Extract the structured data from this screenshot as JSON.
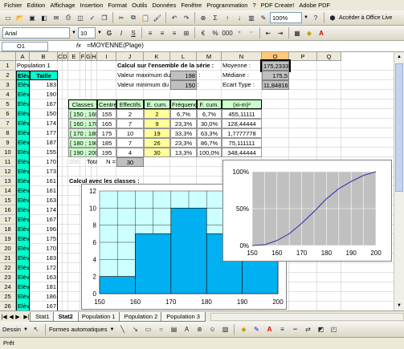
{
  "menu": [
    "Fichier",
    "Edition",
    "Affichage",
    "Insertion",
    "Format",
    "Outils",
    "Données",
    "Fenêtre",
    "Programmation",
    "?",
    "PDF Create!",
    "Adobe PDF"
  ],
  "toolbar": {
    "zoom": "100%",
    "font": "Arial",
    "font_size": "10",
    "office_live": "Accéder à Office Live"
  },
  "formula_bar": {
    "name_box": "O1",
    "fx": "fx",
    "formula": "=MOYENNE(Plage)"
  },
  "columns": [
    "A",
    "B",
    "C",
    "D",
    "E",
    "F",
    "G",
    "H",
    "I",
    "J",
    "K",
    "L",
    "M",
    "N",
    "O",
    "P",
    "Q"
  ],
  "rows": [
    "1",
    "2",
    "3",
    "4",
    "5",
    "6",
    "7",
    "8",
    "9",
    "10",
    "11",
    "12",
    "13",
    "14",
    "15",
    "16",
    "17",
    "18",
    "19",
    "20",
    "21",
    "22",
    "23",
    "24",
    "25",
    "26"
  ],
  "population": {
    "title": "Population 1",
    "header_eleve": "Elève",
    "header_taille": "Taille",
    "students": [
      {
        "name": "Elève 1",
        "taille": "183"
      },
      {
        "name": "Elève 2",
        "taille": "190"
      },
      {
        "name": "Elève 3",
        "taille": "167"
      },
      {
        "name": "Elève 4",
        "taille": "150"
      },
      {
        "name": "Elève 5",
        "taille": "174"
      },
      {
        "name": "Elève 6",
        "taille": "177"
      },
      {
        "name": "Elève 7",
        "taille": "187"
      },
      {
        "name": "Elève 8",
        "taille": "155"
      },
      {
        "name": "Elève 9",
        "taille": "170"
      },
      {
        "name": "Elève 10",
        "taille": "173"
      },
      {
        "name": "Elève 11",
        "taille": "161"
      },
      {
        "name": "Elève 12",
        "taille": "161"
      },
      {
        "name": "Elève 13",
        "taille": "163"
      },
      {
        "name": "Elève 14",
        "taille": "174"
      },
      {
        "name": "Elève 15",
        "taille": "167"
      },
      {
        "name": "Elève 16",
        "taille": "196"
      },
      {
        "name": "Elève 17",
        "taille": "175"
      },
      {
        "name": "Elève 18",
        "taille": "170"
      },
      {
        "name": "Elève 19",
        "taille": "183"
      },
      {
        "name": "Elève 20",
        "taille": "172"
      },
      {
        "name": "Elève 21",
        "taille": "163"
      },
      {
        "name": "Elève 22",
        "taille": "181"
      },
      {
        "name": "Elève 23",
        "taille": "186"
      },
      {
        "name": "Elève 24",
        "taille": "167"
      },
      {
        "name": "Elève 25",
        "taille": "163"
      }
    ]
  },
  "serie": {
    "title": "Calcul sur l'ensemble de la série :",
    "max_label": "Valeur maximum du caractère :",
    "max_value": "198",
    "min_label": "Valeur minimum du caractère :",
    "min_value": "150"
  },
  "stats": [
    {
      "label": "Moyenne :",
      "value": "175,2333"
    },
    {
      "label": "Médiane :",
      "value": "175,5"
    },
    {
      "label": "Ecart Type :",
      "value": "11,84816"
    }
  ],
  "classes_table": {
    "headers": [
      "Classes",
      "Centre",
      "Effectifs",
      "E. cum.",
      "Fréquence",
      "F. cum.",
      "(xi-m)²"
    ],
    "rows": [
      [
        "[ 150 ; 160 [",
        "155",
        "2",
        "2",
        "6,7%",
        "6,7%",
        "455,11111"
      ],
      [
        "[ 160 ; 170 [",
        "165",
        "7",
        "9",
        "23,3%",
        "30,0%",
        "128,44444"
      ],
      [
        "[ 170 ; 180 [",
        "175",
        "10",
        "19",
        "33,3%",
        "63,3%",
        "1,7777778"
      ],
      [
        "[ 180 ; 190 [",
        "185",
        "7",
        "26",
        "23,3%",
        "86,7%",
        "75,111111"
      ],
      [
        "[ 190 ; 200 [",
        "195",
        "4",
        "30",
        "13,3%",
        "100,0%",
        "348,44444"
      ]
    ],
    "total_prefix": "200",
    "total_label": "Total",
    "n_label": "N =",
    "n_value": "30"
  },
  "classes_title": "Calcul avec les classes :",
  "tabs": [
    "Stat1",
    "Stat2",
    "Population 1",
    "Population 2",
    "Population 3"
  ],
  "active_tab": "Stat2",
  "drawbar": {
    "dessin": "Dessin",
    "formes": "Formes automatiques"
  },
  "status": "Prêt",
  "chart_data": [
    {
      "type": "bar",
      "x_ticks": [
        "150",
        "160",
        "170",
        "180",
        "190",
        "200"
      ],
      "y_ticks": [
        "0",
        "2",
        "4",
        "6",
        "8",
        "10",
        "12"
      ],
      "ylim": [
        0,
        12
      ],
      "bin_edges": [
        150,
        160,
        170,
        180,
        190,
        200
      ],
      "values": [
        2,
        7,
        10,
        7,
        4
      ],
      "bar_color": "#00b0f0",
      "plot_bg": "#ccffff",
      "grid": true
    },
    {
      "type": "line",
      "x_ticks": [
        "150",
        "160",
        "170",
        "180",
        "190",
        "200"
      ],
      "y_ticks": [
        "0%",
        "50%",
        "100%"
      ],
      "xlim": [
        150,
        200
      ],
      "ylim": [
        0,
        1
      ],
      "x": [
        150,
        155,
        160,
        165,
        170,
        175,
        180,
        185,
        190,
        195,
        200
      ],
      "y": [
        0.0,
        0.01,
        0.067,
        0.16,
        0.3,
        0.46,
        0.633,
        0.77,
        0.867,
        0.95,
        1.0
      ],
      "line_color": "#3333aa",
      "plot_bg": "#c0c0c0",
      "grid": true
    }
  ]
}
